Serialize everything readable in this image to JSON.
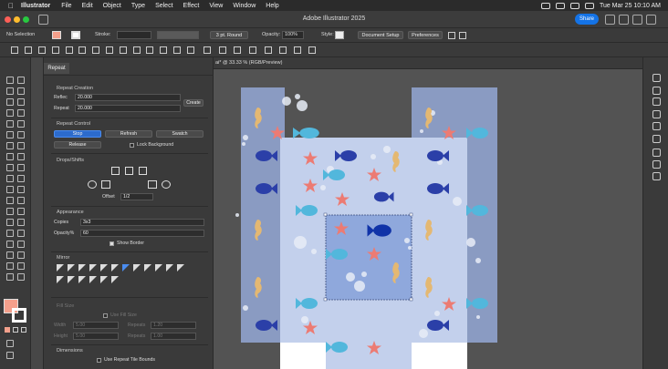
{
  "menubar": {
    "app": "Illustrator",
    "items": [
      "File",
      "Edit",
      "Object",
      "Type",
      "Select",
      "Effect",
      "View",
      "Window",
      "Help"
    ],
    "datetime": "Tue Mar 25  10:10 AM"
  },
  "titlebar": {
    "title": "Adobe Illustrator 2025",
    "share": "Share"
  },
  "control": {
    "selection": "No Selection",
    "stroke_label": "Stroke:",
    "brush": "3 pt. Round",
    "opacity_label": "Opacity:",
    "opacity_value": "100%",
    "style_label": "Style:",
    "doc_setup": "Document Setup",
    "preferences": "Preferences"
  },
  "doctab": {
    "label": "ai* @ 33.33 % (RGB/Preview)"
  },
  "panel": {
    "tab": "Repeat",
    "repeat_creation": {
      "title": "Repeat Creation",
      "reflect_label": "Reflec",
      "reflect_value": "20.000",
      "repeat_label": "Repeat",
      "repeat_value": "20.000",
      "create": "Create"
    },
    "repeat_control": {
      "title": "Repeat Control",
      "stop": "Stop",
      "refresh": "Refresh",
      "swatch": "Swatch",
      "release": "Release",
      "lock_bg": "Lock Background"
    },
    "drops": {
      "title": "Drops/Shifts",
      "offset_label": "Offset",
      "offset_value": "1/2"
    },
    "appearance": {
      "title": "Appearance",
      "copies_label": "Copies",
      "copies_value": "3x3",
      "opacity_label": "Opacity%",
      "opacity_value": "60",
      "show_border": "Show Border"
    },
    "mirror": {
      "title": "Mirror"
    },
    "fill_size": {
      "title": "Fill Size",
      "use_fill": "Use Fill Size",
      "width_label": "Width",
      "width_value": "5.00",
      "repeats_label": "Repeats",
      "repeats_w": "1.20",
      "height_label": "Height",
      "height_value": "5.00",
      "repeats_h": "1.00"
    },
    "dimensions": {
      "title": "Dimensions",
      "use_tile": "Use Repeat Tile Bounds"
    }
  },
  "colors": {
    "accent": "#1473e6",
    "fill_swatch": "#f4a08c",
    "tile_bg": "#c3d0ec",
    "center_tile": "#8fa8dc",
    "side_tile": "#8a9bc2",
    "fish_dark": "#2b3fa8",
    "fish_light": "#52b7dc",
    "starfish": "#ec7b73",
    "seahorse": "#e4b872"
  }
}
